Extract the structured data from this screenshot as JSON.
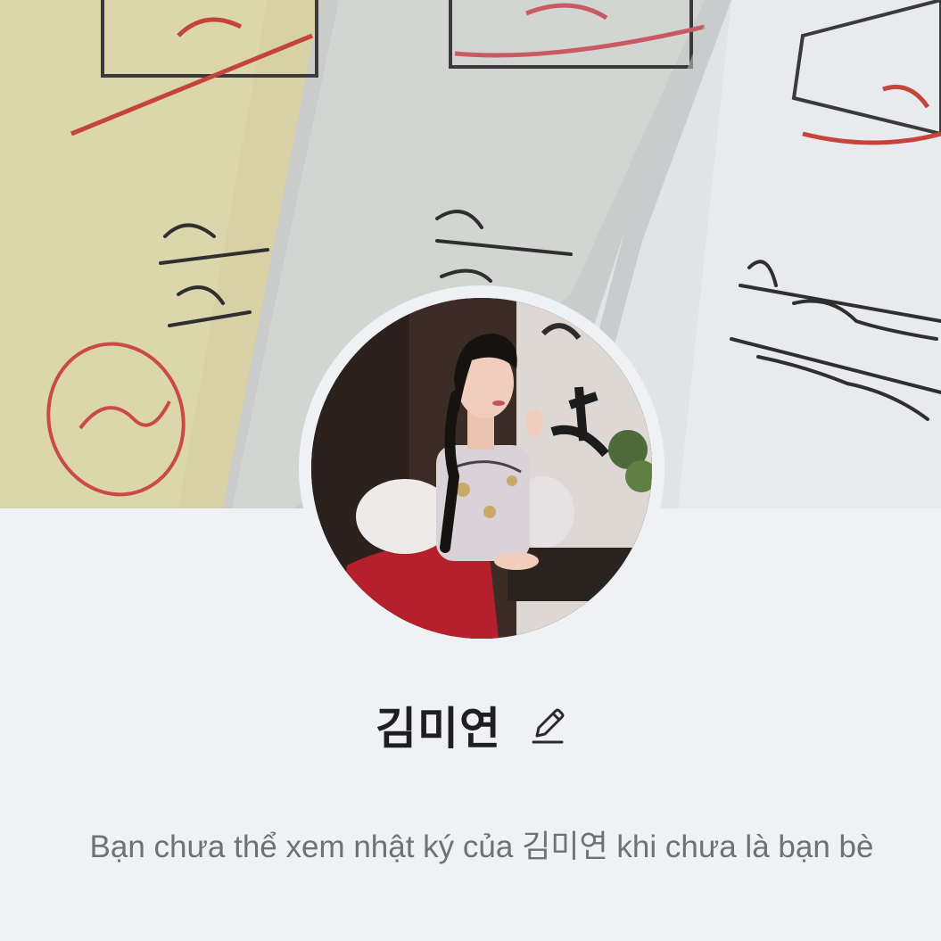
{
  "profile": {
    "name": "김미연",
    "edit_icon": "pencil-icon"
  },
  "notice": {
    "text": "Bạn chưa thể xem nhật ký của 김미연 khi chưa là bạn bè"
  },
  "colors": {
    "background": "#f0f1f5",
    "name_text": "#1f1f21",
    "notice_text": "#6f7176"
  }
}
